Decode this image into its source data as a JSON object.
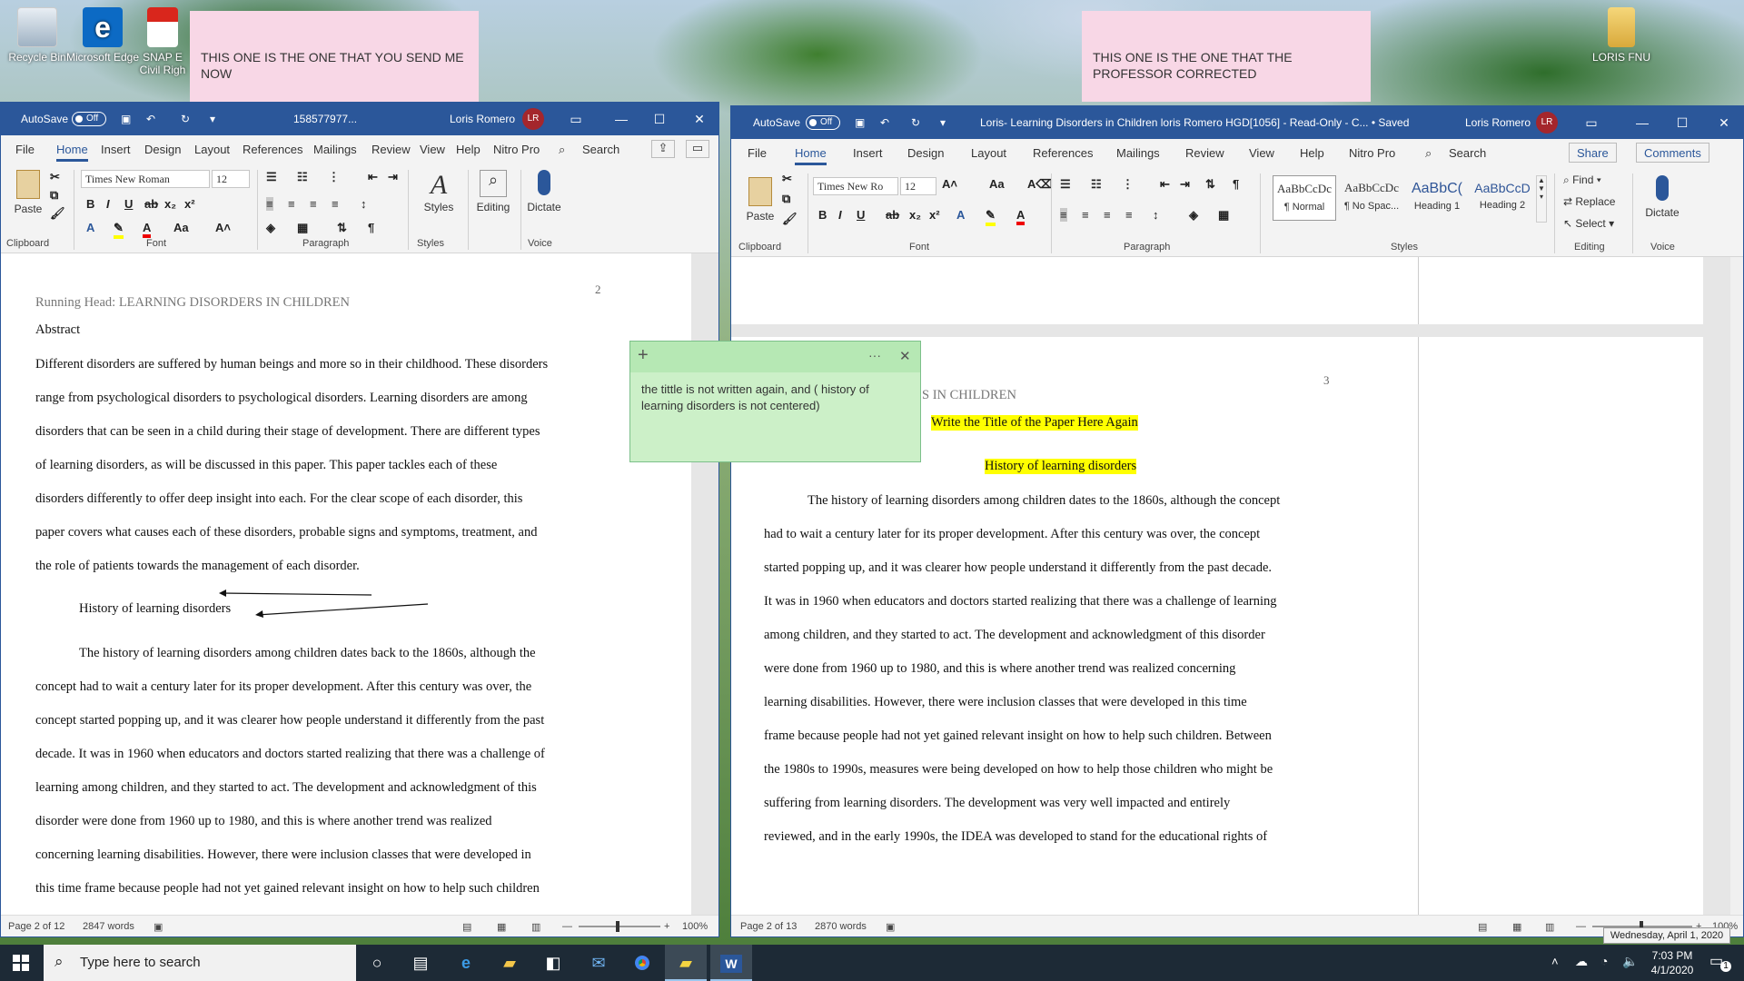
{
  "desktop": {
    "icons": [
      {
        "label": "Recycle Bin",
        "icon": "recycle-bin-icon"
      },
      {
        "label": "Microsoft Edge",
        "icon": "edge-icon"
      },
      {
        "label": "SNAP E Civil Righ",
        "icon": "pdf-icon"
      },
      {
        "label": "LORIS FNU",
        "icon": "folder-icon"
      }
    ],
    "sticky_left": "THIS ONE IS THE ONE THAT YOU SEND ME NOW",
    "sticky_right": "THIS ONE IS THE ONE THAT THE PROFESSOR CORRECTED",
    "sticky_green": "the tittle is not written again, and ( history of learning disorders is not centered)"
  },
  "left_window": {
    "autosave": "AutoSave",
    "toggle": "Off",
    "title": "158577977...",
    "user": "Loris Romero",
    "initials": "LR",
    "tabs": [
      "File",
      "Home",
      "Insert",
      "Design",
      "Layout",
      "References",
      "Mailings",
      "Review",
      "View",
      "Help",
      "Nitro Pro"
    ],
    "search": "Search",
    "font": "Times New Roman",
    "size": "12",
    "groups": {
      "clipboard": "Clipboard",
      "font": "Font",
      "paragraph": "Paragraph",
      "styles": "Styles",
      "voice": "Voice"
    },
    "buttons": {
      "paste": "Paste",
      "styles": "Styles",
      "editing": "Editing",
      "dictate": "Dictate"
    },
    "page_number": "2",
    "running_head": "Running Head: LEARNING DISORDERS IN CHILDREN",
    "abstract_heading": "Abstract",
    "abstract_lines": [
      "Different disorders are suffered by human beings and more so in their childhood. These disorders",
      "range from psychological disorders to psychological disorders. Learning disorders are among",
      "disorders that can be seen in a child during their stage of development. There are different types",
      "of learning disorders, as will be discussed in this paper. This paper tackles each of these",
      "disorders differently to offer deep insight into each. For the clear scope of each disorder, this",
      "paper covers what causes each of these disorders, probable signs and symptoms, treatment, and",
      "the role of patients towards the management of each disorder."
    ],
    "section_heading": "History of learning disorders",
    "body_lines": [
      "The history of learning disorders among children dates back to the 1860s, although the",
      "concept had to wait a century later for its proper development. After this century was over, the",
      "concept started popping up, and it was clearer how people understand it differently from the past",
      "decade. It was in 1960 when educators and doctors started realizing that there was a challenge of",
      "learning among children, and they started to act. The development and acknowledgment of this",
      "disorder were done from 1960 up to 1980, and this is where another trend was realized",
      "concerning learning disabilities. However, there were inclusion classes that were developed in",
      "this time frame because people had not yet gained relevant insight on how to help such children"
    ],
    "status": {
      "page": "Page 2 of 12",
      "words": "2847 words",
      "zoom": "100%"
    }
  },
  "right_window": {
    "autosave": "AutoSave",
    "toggle": "Off",
    "title": "Loris- Learning Disorders in Children loris Romero HGD[1056]  -  Read-Only  -  C...  •  Saved",
    "user": "Loris Romero",
    "initials": "LR",
    "tabs": [
      "File",
      "Home",
      "Insert",
      "Design",
      "Layout",
      "References",
      "Mailings",
      "Review",
      "View",
      "Help",
      "Nitro Pro"
    ],
    "search": "Search",
    "share": "Share",
    "comments": "Comments",
    "font": "Times New Ro",
    "size": "12",
    "styles": [
      {
        "preview": "AaBbCcDc",
        "name": "¶ Normal"
      },
      {
        "preview": "AaBbCcDc",
        "name": "¶ No Spac..."
      },
      {
        "preview": "AaBbC(",
        "name": "Heading 1"
      },
      {
        "preview": "AaBbCcD",
        "name": "Heading 2"
      }
    ],
    "editing": {
      "find": "Find",
      "replace": "Replace",
      "select": "Select"
    },
    "groups": {
      "clipboard": "Clipboard",
      "font": "Font",
      "paragraph": "Paragraph",
      "styles": "Styles",
      "editing": "Editing",
      "voice": "Voice"
    },
    "buttons": {
      "paste": "Paste",
      "dictate": "Dictate"
    },
    "page_number": "3",
    "running_head": "S IN CHILDREN",
    "title_again": "Write the Title of the Paper Here Again",
    "section_heading": "History of learning disorders",
    "body_lines": [
      "The history of learning disorders among children dates to the 1860s, although the concept",
      "had to wait a century later for its proper development. After this century was over, the concept",
      "started popping up, and it was clearer how people understand it differently from the past decade.",
      "It was in 1960 when educators and doctors started realizing that there was a challenge of learning",
      "among children, and they started to act. The development and acknowledgment of this disorder",
      "were done from 1960 up to 1980, and this is where another trend was realized concerning",
      "learning disabilities. However, there were inclusion classes that were developed in this time",
      "frame because people had not yet gained relevant insight on how to help such children. Between",
      "the 1980s to 1990s, measures were being developed on how to help those children who might be",
      "suffering from learning disorders. The development was very well impacted and entirely",
      "reviewed, and in the early 1990s, the IDEA was developed to stand for the educational rights of"
    ],
    "status": {
      "page": "Page 2 of 13",
      "words": "2870 words",
      "zoom": "100%"
    }
  },
  "taskbar": {
    "search": "Type here to search",
    "time": "7:03 PM",
    "date": "4/1/2020",
    "tooltip": "Wednesday, April 1, 2020",
    "notifications": "1"
  },
  "colors": {
    "word_blue": "#2b579a",
    "highlight": "#ffff00",
    "sticky_green": "#ccf0c8",
    "sticky_pink": "#f8d7e6"
  }
}
